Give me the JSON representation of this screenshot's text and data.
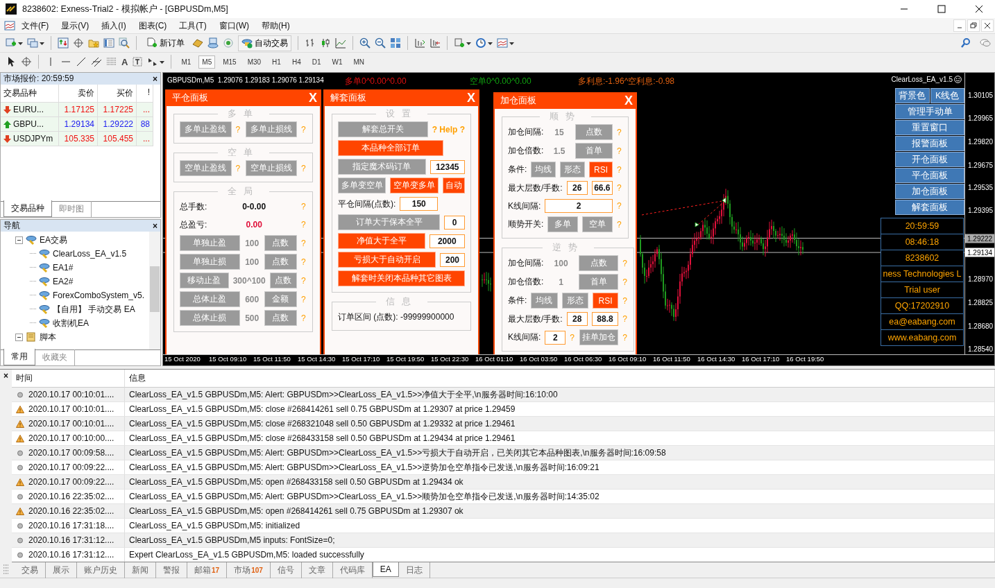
{
  "window": {
    "title": "8238602: Exness-Trial2 - 模拟帐户 - [GBPUSDm,M5]"
  },
  "menu": [
    "文件(F)",
    "显示(V)",
    "插入(I)",
    "图表(C)",
    "工具(T)",
    "窗口(W)",
    "帮助(H)"
  ],
  "toolbar": {
    "new_order": "新订单",
    "auto_trading": "自动交易"
  },
  "drawing_toolbar": {
    "text_tool": "A",
    "timeframes": [
      {
        "label": "M1",
        "selected": false
      },
      {
        "label": "M5",
        "selected": true
      },
      {
        "label": "M15",
        "selected": false
      },
      {
        "label": "M30",
        "selected": false
      },
      {
        "label": "H1",
        "selected": false
      },
      {
        "label": "H4",
        "selected": false
      },
      {
        "label": "D1",
        "selected": false
      },
      {
        "label": "W1",
        "selected": false
      },
      {
        "label": "MN",
        "selected": false
      }
    ]
  },
  "market_watch": {
    "title": "市场报价: 20:59:59",
    "close": "×",
    "columns": [
      "交易品种",
      "卖价",
      "买价",
      "!"
    ],
    "rows": [
      {
        "symbol": "EURU...",
        "bid": "1.17125",
        "ask": "1.17225",
        "spread": "...",
        "rising": false
      },
      {
        "symbol": "GBPU...",
        "bid": "1.29134",
        "ask": "1.29222",
        "spread": "88",
        "rising": true
      },
      {
        "symbol": "USDJPYm",
        "bid": "105.335",
        "ask": "105.455",
        "spread": "...",
        "rising": false
      }
    ],
    "tabs": [
      {
        "label": "交易品种",
        "selected": true
      },
      {
        "label": "即时图",
        "selected": false
      }
    ]
  },
  "navigator": {
    "title": "导航",
    "close": "×",
    "tree": [
      {
        "label": "EA交易",
        "kind": "experts",
        "expanded": true,
        "children": [
          {
            "label": "ClearLoss_EA_v1.5"
          },
          {
            "label": "EA1#"
          },
          {
            "label": "EA2#"
          },
          {
            "label": "ForexComboSystem_v5."
          },
          {
            "label": "【自用】 手动交易 EA"
          },
          {
            "label": "收割机EA"
          }
        ]
      },
      {
        "label": "脚本",
        "kind": "scripts",
        "expanded": true
      }
    ],
    "tabs": [
      {
        "label": "常用",
        "selected": true
      },
      {
        "label": "收藏夹",
        "selected": false
      }
    ]
  },
  "chart": {
    "header": "GBPUSDm,M5  1.29076 1.29183 1.29076 1.29134",
    "long_info": "多单0^0.00^0.00",
    "short_info": "空单0^0.00^0.00",
    "swap_info": "多利息:-1.96^空利息:-0.98",
    "ea_name": "ClearLoss_EA_v1.5",
    "price_axis": [
      {
        "label": "1.30105",
        "kind": "tick"
      },
      {
        "label": "1.29965",
        "kind": "tick"
      },
      {
        "label": "1.29820",
        "kind": "tick"
      },
      {
        "label": "1.29675",
        "kind": "tick"
      },
      {
        "label": "1.29535",
        "kind": "tick"
      },
      {
        "label": "1.29395",
        "kind": "tick"
      },
      {
        "label": "1.29222",
        "kind": "ask"
      },
      {
        "label": "1.29134",
        "kind": "bid"
      },
      {
        "label": "1.28970",
        "kind": "tick"
      },
      {
        "label": "1.28825",
        "kind": "tick"
      },
      {
        "label": "1.28680",
        "kind": "tick"
      },
      {
        "label": "1.28540",
        "kind": "tick"
      }
    ],
    "time_axis": [
      "15 Oct 2020",
      "15 Oct 09:10",
      "15 Oct 11:50",
      "15 Oct 14:30",
      "15 Oct 17:10",
      "15 Oct 19:50",
      "15 Oct 22:30",
      "16 Oct 01:10",
      "16 Oct 03:50",
      "16 Oct 06:30",
      "16 Oct 09:10",
      "16 Oct 11:50",
      "16 Oct 14:30",
      "16 Oct 17:10",
      "16 Oct 19:50"
    ],
    "panels": [
      {
        "title": "平仓面板",
        "close": "X",
        "sections": [
          {
            "title": "多单",
            "rows": [
              {
                "items": [
                  {
                    "kind": "button",
                    "label": "多单止盈线",
                    "on": false
                  },
                  {
                    "kind": "help",
                    "text": "?"
                  },
                  {
                    "kind": "button",
                    "label": "多单止损线",
                    "on": false
                  },
                  {
                    "kind": "help",
                    "text": "?"
                  }
                ]
              }
            ]
          },
          {
            "title": "空单",
            "rows": [
              {
                "items": [
                  {
                    "kind": "button",
                    "label": "空单止盈线",
                    "on": false
                  },
                  {
                    "kind": "help",
                    "text": "?"
                  },
                  {
                    "kind": "button",
                    "label": "空单止损线",
                    "on": false
                  },
                  {
                    "kind": "help",
                    "text": "?"
                  }
                ]
              }
            ]
          },
          {
            "title": "全局",
            "rows": [
              {
                "items": [
                  {
                    "kind": "label",
                    "text": "总手数:"
                  },
                  {
                    "kind": "number",
                    "text": "0-0.00"
                  },
                  {
                    "kind": "help",
                    "text": "?"
                  }
                ]
              },
              {
                "items": [
                  {
                    "kind": "label",
                    "text": "总盈亏:"
                  },
                  {
                    "kind": "number-loss",
                    "text": "0.00"
                  },
                  {
                    "kind": "help",
                    "text": "?"
                  }
                ]
              },
              {
                "items": [
                  {
                    "kind": "button",
                    "label": "单独止盈",
                    "on": false
                  },
                  {
                    "kind": "number-muted",
                    "text": "100"
                  },
                  {
                    "kind": "button",
                    "label": "点数",
                    "on": false
                  },
                  {
                    "kind": "help",
                    "text": "?"
                  }
                ]
              },
              {
                "items": [
                  {
                    "kind": "button",
                    "label": "单独止损",
                    "on": false
                  },
                  {
                    "kind": "number-muted",
                    "text": "100"
                  },
                  {
                    "kind": "button",
                    "label": "点数",
                    "on": false
                  },
                  {
                    "kind": "help",
                    "text": "?"
                  }
                ]
              },
              {
                "items": [
                  {
                    "kind": "button",
                    "label": "移动止盈",
                    "on": false
                  },
                  {
                    "kind": "number-muted",
                    "text": "300^100"
                  },
                  {
                    "kind": "button",
                    "label": "点数",
                    "on": false
                  },
                  {
                    "kind": "help",
                    "text": "?"
                  }
                ]
              },
              {
                "items": [
                  {
                    "kind": "button",
                    "label": "总体止盈",
                    "on": false
                  },
                  {
                    "kind": "number-muted",
                    "text": "600"
                  },
                  {
                    "kind": "button",
                    "label": "金额",
                    "on": false
                  },
                  {
                    "kind": "help",
                    "text": "?"
                  }
                ]
              },
              {
                "items": [
                  {
                    "kind": "button",
                    "label": "总体止损",
                    "on": false
                  },
                  {
                    "kind": "number-muted",
                    "text": "500"
                  },
                  {
                    "kind": "button",
                    "label": "点数",
                    "on": false
                  },
                  {
                    "kind": "help",
                    "text": "?"
                  }
                ]
              }
            ]
          }
        ]
      },
      {
        "title": "解套面板",
        "close": "X",
        "sections": [
          {
            "title": "设置",
            "rows": [
              {
                "items": [
                  {
                    "kind": "button",
                    "label": "解套总开关",
                    "on": false
                  },
                  {
                    "kind": "link",
                    "text": "? Help ?"
                  }
                ]
              },
              {
                "items": [
                  {
                    "kind": "button",
                    "label": "本品种全部订单",
                    "on": true
                  },
                  {
                    "kind": "spacer"
                  }
                ]
              },
              {
                "items": [
                  {
                    "kind": "button",
                    "label": "指定魔术码订单",
                    "on": false
                  },
                  {
                    "kind": "field",
                    "value": "12345"
                  }
                ]
              },
              {
                "items": [
                  {
                    "kind": "button",
                    "label": "多单变空单",
                    "on": false
                  },
                  {
                    "kind": "button",
                    "label": "空单变多单",
                    "on": true
                  },
                  {
                    "kind": "button",
                    "label": "自动",
                    "on": true
                  }
                ]
              },
              {
                "items": [
                  {
                    "kind": "label",
                    "text": "平仓间隔(点数):"
                  },
                  {
                    "kind": "field",
                    "value": "150"
                  },
                  {
                    "kind": "spacer"
                  }
                ]
              },
              {
                "items": [
                  {
                    "kind": "button",
                    "label": "订单大于保本全平",
                    "on": false
                  },
                  {
                    "kind": "field",
                    "value": "0"
                  }
                ]
              },
              {
                "items": [
                  {
                    "kind": "button",
                    "label": "净值大于全平",
                    "on": true
                  },
                  {
                    "kind": "field",
                    "value": "2000"
                  }
                ]
              },
              {
                "items": [
                  {
                    "kind": "button",
                    "label": "亏损大于自动开启",
                    "on": true
                  },
                  {
                    "kind": "field",
                    "value": "200"
                  }
                ]
              },
              {
                "items": [
                  {
                    "kind": "button",
                    "label": "解套时关闭本品种其它图表",
                    "on": true
                  }
                ]
              }
            ]
          },
          {
            "title": "信息",
            "rows": [
              {
                "items": [
                  {
                    "kind": "label",
                    "text": "订单区间 (点数): -99999900000"
                  }
                ]
              }
            ]
          }
        ]
      },
      {
        "title": "加仓面板",
        "close": "X",
        "sections": [
          {
            "title": "顺势",
            "rows": [
              {
                "items": [
                  {
                    "kind": "label",
                    "text": "加仓间隔:"
                  },
                  {
                    "kind": "number-muted",
                    "text": "15"
                  },
                  {
                    "kind": "button",
                    "label": "点数",
                    "on": false
                  },
                  {
                    "kind": "help",
                    "text": "?"
                  }
                ]
              },
              {
                "items": [
                  {
                    "kind": "label",
                    "text": "加仓倍数:"
                  },
                  {
                    "kind": "number-muted",
                    "text": "1.5"
                  },
                  {
                    "kind": "button",
                    "label": "首单",
                    "on": false
                  },
                  {
                    "kind": "help",
                    "text": "?"
                  }
                ]
              },
              {
                "items": [
                  {
                    "kind": "label",
                    "text": "条件:"
                  },
                  {
                    "kind": "button",
                    "label": "均线",
                    "on": false
                  },
                  {
                    "kind": "button",
                    "label": "形态",
                    "on": false
                  },
                  {
                    "kind": "button",
                    "label": "RSI",
                    "on": true
                  },
                  {
                    "kind": "help",
                    "text": "?"
                  }
                ]
              },
              {
                "items": [
                  {
                    "kind": "label",
                    "text": "最大层数/手数:"
                  },
                  {
                    "kind": "field",
                    "value": "26"
                  },
                  {
                    "kind": "field",
                    "value": "66.6"
                  },
                  {
                    "kind": "help",
                    "text": "?"
                  }
                ]
              },
              {
                "items": [
                  {
                    "kind": "label",
                    "text": "K线间隔:"
                  },
                  {
                    "kind": "field",
                    "value": "2"
                  },
                  {
                    "kind": "help",
                    "text": "?"
                  }
                ]
              },
              {
                "items": [
                  {
                    "kind": "label",
                    "text": "顺势开关:"
                  },
                  {
                    "kind": "button",
                    "label": "多单",
                    "on": false
                  },
                  {
                    "kind": "button",
                    "label": "空单",
                    "on": false
                  },
                  {
                    "kind": "help",
                    "text": "?"
                  }
                ]
              }
            ]
          },
          {
            "title": "逆势",
            "rows": [
              {
                "items": [
                  {
                    "kind": "label",
                    "text": "加仓间隔:"
                  },
                  {
                    "kind": "number-muted",
                    "text": "100"
                  },
                  {
                    "kind": "button",
                    "label": "点数",
                    "on": false
                  },
                  {
                    "kind": "help",
                    "text": "?"
                  }
                ]
              },
              {
                "items": [
                  {
                    "kind": "label",
                    "text": "加仓倍数:"
                  },
                  {
                    "kind": "number-muted",
                    "text": "1"
                  },
                  {
                    "kind": "button",
                    "label": "首单",
                    "on": false
                  },
                  {
                    "kind": "help",
                    "text": "?"
                  }
                ]
              },
              {
                "items": [
                  {
                    "kind": "label",
                    "text": "条件:"
                  },
                  {
                    "kind": "button",
                    "label": "均线",
                    "on": false
                  },
                  {
                    "kind": "button",
                    "label": "形态",
                    "on": false
                  },
                  {
                    "kind": "button",
                    "label": "RSI",
                    "on": true
                  },
                  {
                    "kind": "help",
                    "text": "?"
                  }
                ]
              },
              {
                "items": [
                  {
                    "kind": "label",
                    "text": "最大层数/手数:"
                  },
                  {
                    "kind": "field",
                    "value": "28"
                  },
                  {
                    "kind": "field",
                    "value": "88.8"
                  },
                  {
                    "kind": "help",
                    "text": "?"
                  }
                ]
              },
              {
                "items": [
                  {
                    "kind": "label",
                    "text": "K线间隔:"
                  },
                  {
                    "kind": "field",
                    "value": "2"
                  },
                  {
                    "kind": "help",
                    "text": "?"
                  },
                  {
                    "kind": "button",
                    "label": "挂单加仓",
                    "on": false
                  },
                  {
                    "kind": "help",
                    "text": "?"
                  }
                ]
              }
            ]
          }
        ]
      }
    ],
    "side_buttons": [
      [
        "背景色",
        "K线色"
      ],
      [
        "管理手动单"
      ],
      [
        "重置窗口"
      ],
      [
        "报警面板"
      ],
      [
        "开仓面板"
      ],
      [
        "平仓面板"
      ],
      [
        "加仓面板"
      ],
      [
        "解套面板"
      ]
    ],
    "info_boxes": [
      "20:59:59",
      "08:46:18",
      "8238602",
      "ness Technologies L",
      "Trial user",
      "QQ:17202910",
      "ea@eabang.com",
      "www.eabang.com"
    ]
  },
  "terminal": {
    "close": "×",
    "columns": [
      "时间",
      "信息"
    ],
    "rows": [
      {
        "kind": "info",
        "time": "2020.10.17 00:10:01....",
        "message": "ClearLoss_EA_v1.5 GBPUSDm,M5: Alert: GBPUSDm>>ClearLoss_EA_v1.5>>净值大于全平,\\n服务器时间:16:10:00"
      },
      {
        "kind": "warning",
        "time": "2020.10.17 00:10:01....",
        "message": "ClearLoss_EA_v1.5 GBPUSDm,M5: close #268414261 sell 0.75 GBPUSDm at 1.29307 at price 1.29459"
      },
      {
        "kind": "warning",
        "time": "2020.10.17 00:10:01....",
        "message": "ClearLoss_EA_v1.5 GBPUSDm,M5: close #268321048 sell 0.50 GBPUSDm at 1.29332 at price 1.29461"
      },
      {
        "kind": "warning",
        "time": "2020.10.17 00:10:00....",
        "message": "ClearLoss_EA_v1.5 GBPUSDm,M5: close #268433158 sell 0.50 GBPUSDm at 1.29434 at price 1.29461"
      },
      {
        "kind": "info",
        "time": "2020.10.17 00:09:58....",
        "message": "ClearLoss_EA_v1.5 GBPUSDm,M5: Alert: GBPUSDm>>ClearLoss_EA_v1.5>>亏损大于自动开启，已关闭其它本品种图表,\\n服务器时间:16:09:58"
      },
      {
        "kind": "info",
        "time": "2020.10.17 00:09:22....",
        "message": "ClearLoss_EA_v1.5 GBPUSDm,M5: Alert: GBPUSDm>>ClearLoss_EA_v1.5>>逆势加仓空单指令已发送,\\n服务器时间:16:09:21"
      },
      {
        "kind": "warning",
        "time": "2020.10.17 00:09:22....",
        "message": "ClearLoss_EA_v1.5 GBPUSDm,M5: open #268433158 sell 0.50 GBPUSDm at 1.29434 ok"
      },
      {
        "kind": "info",
        "time": "2020.10.16 22:35:02....",
        "message": "ClearLoss_EA_v1.5 GBPUSDm,M5: Alert: GBPUSDm>>ClearLoss_EA_v1.5>>顺势加仓空单指令已发送,\\n服务器时间:14:35:02"
      },
      {
        "kind": "warning",
        "time": "2020.10.16 22:35:02....",
        "message": "ClearLoss_EA_v1.5 GBPUSDm,M5: open #268414261 sell 0.75 GBPUSDm at 1.29307 ok"
      },
      {
        "kind": "info",
        "time": "2020.10.16 17:31:18....",
        "message": "ClearLoss_EA_v1.5 GBPUSDm,M5: initialized"
      },
      {
        "kind": "info",
        "time": "2020.10.16 17:31:12....",
        "message": "ClearLoss_EA_v1.5 GBPUSDm,M5 inputs: FontSize=0;"
      },
      {
        "kind": "info",
        "time": "2020.10.16 17:31:12....",
        "message": "Expert ClearLoss_EA_v1.5 GBPUSDm,M5: loaded successfully"
      }
    ],
    "tabs": [
      {
        "label": "交易",
        "selected": false
      },
      {
        "label": "展示",
        "selected": false
      },
      {
        "label": "账户历史",
        "selected": false
      },
      {
        "label": "新闻",
        "selected": false
      },
      {
        "label": "警报",
        "selected": false
      },
      {
        "label": "邮箱",
        "count": "17",
        "selected": false
      },
      {
        "label": "市场",
        "count": "107",
        "selected": false
      },
      {
        "label": "信号",
        "selected": false
      },
      {
        "label": "文章",
        "selected": false
      },
      {
        "label": "代码库",
        "selected": false
      },
      {
        "label": "EA",
        "selected": true
      },
      {
        "label": "日志",
        "selected": false
      }
    ]
  }
}
